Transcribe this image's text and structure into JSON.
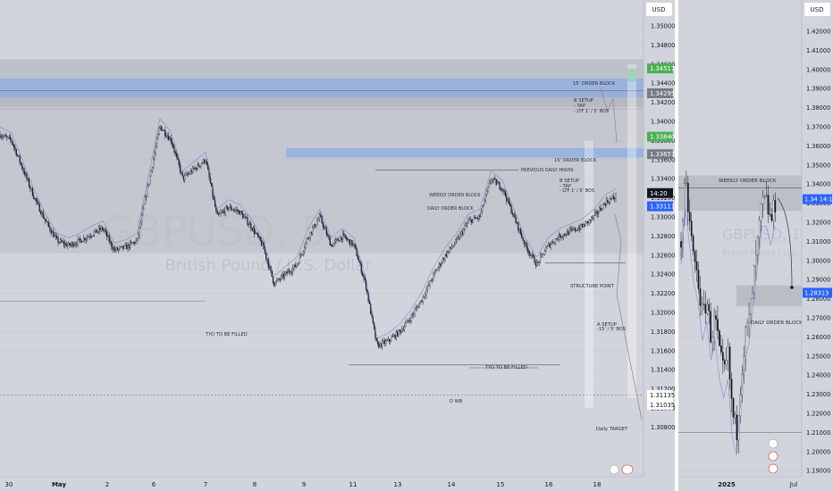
{
  "left_chart": {
    "currency": "USD",
    "price_ticks": [
      "1.35000",
      "1.34800",
      "1.34600",
      "1.34400",
      "1.34200",
      "1.34000",
      "1.33800",
      "1.33600",
      "1.33400",
      "1.33200",
      "1.33000",
      "1.32800",
      "1.32600",
      "1.32400",
      "1.32200",
      "1.32000",
      "1.31800",
      "1.31600",
      "1.31400",
      "1.31200",
      "1.31000",
      "1.30800"
    ],
    "price_labels": [
      {
        "value": "1.34517",
        "color": "#4caf50",
        "text_color": "#ffffff",
        "price": 1.34555
      },
      {
        "value": "1.34295",
        "color": "#787b86",
        "text_color": "#ffffff",
        "price": 1.34295
      },
      {
        "value": "1.33840",
        "color": "#4caf50",
        "text_color": "#ffffff",
        "price": 1.3384
      },
      {
        "value": "1.33657",
        "color": "#787b86",
        "text_color": "#ffffff",
        "price": 1.33657
      },
      {
        "value": "14:20",
        "color": "#131722",
        "text_color": "#ffffff",
        "price": 1.3325
      },
      {
        "value": "1.33111",
        "color": "#2962ff",
        "text_color": "#ffffff",
        "price": 1.33111
      },
      {
        "value": "1.31135",
        "color": "#ffffff",
        "text_color": "#131722",
        "price": 1.31135
      },
      {
        "value": "1.31035",
        "color": "#ffffff",
        "text_color": "#131722",
        "price": 1.31035
      }
    ],
    "time_ticks": [
      "30",
      "May",
      "2",
      "6",
      "7",
      "8",
      "9",
      "11",
      "13",
      "14",
      "15",
      "16",
      "18"
    ],
    "annotations": [
      "15' ORDER BLOCK",
      "B SETUP",
      "- TAP",
      "- LTF 1' / 5' BOS",
      "15' ORDER BLOCK",
      "PREVIOUS DAILY HIGHS",
      "B SETUP",
      "- TAP",
      "- LTF 1' / 5' BOS",
      "WEEKLY ORDER BLOCK",
      "DAILY ORDER BLOCK",
      "STRUCTURE POINT",
      "A SETUP",
      "-15' / 5' BOS",
      "TYO TO BE FILLED",
      "TYO TO BE FILLED",
      "D WB",
      "Daily TARGET"
    ],
    "watermark": {
      "symbol": "GBPUSD, 5",
      "name": "British Pound / U.S. Dollar"
    }
  },
  "right_chart": {
    "currency": "USD",
    "price_ticks": [
      "1.42000",
      "1.41000",
      "1.40000",
      "1.39000",
      "1.38000",
      "1.37000",
      "1.36000",
      "1.35000",
      "1.34000",
      "1.33000",
      "1.32000",
      "1.31000",
      "1.30000",
      "1.29000",
      "1.28000",
      "1.27000",
      "1.26000",
      "1.25000",
      "1.24000",
      "1.23000",
      "1.22000",
      "1.21000",
      "1.20000",
      "1.19000"
    ],
    "price_labels": [
      {
        "value": "1.34 14:19",
        "color": "#2962ff",
        "text_color": "#ffffff",
        "price": 1.3321
      },
      {
        "value": "1.28313",
        "color": "#2962ff",
        "text_color": "#ffffff",
        "price": 1.2831
      }
    ],
    "time_ticks": [
      "2025",
      "Jul"
    ],
    "annotations": [
      "WEEKLY ORDER BLOCK",
      "DAILY ORDER BLOCK"
    ],
    "watermark": {
      "symbol": "GBPUSD, 1W",
      "name": "British Pound / U.S. Dollar"
    }
  },
  "chart_data": [
    {
      "type": "candlestick",
      "title": "",
      "series_name": "",
      "x": [
        "30",
        "May",
        "2",
        "6",
        "7",
        "8",
        "9",
        "11",
        "13",
        "14",
        "15",
        "16",
        "18"
      ],
      "ylim": [
        1.3075,
        1.351
      ],
      "close_path": [
        [
          0,
          1.3386
        ],
        [
          1,
          1.338
        ],
        [
          2,
          1.335
        ],
        [
          3,
          1.332
        ],
        [
          4,
          1.3295
        ],
        [
          5,
          1.3275
        ],
        [
          6,
          1.327
        ],
        [
          7,
          1.3275
        ],
        [
          8,
          1.3282
        ],
        [
          9,
          1.3288
        ],
        [
          10,
          1.3265
        ],
        [
          11,
          1.3268
        ],
        [
          12,
          1.3275
        ],
        [
          13,
          1.3335
        ],
        [
          14,
          1.3395
        ],
        [
          15,
          1.338
        ],
        [
          16,
          1.334
        ],
        [
          17,
          1.335
        ],
        [
          18,
          1.336
        ],
        [
          19,
          1.33
        ],
        [
          20,
          1.331
        ],
        [
          21,
          1.3305
        ],
        [
          22,
          1.329
        ],
        [
          23,
          1.327
        ],
        [
          24,
          1.323
        ],
        [
          25,
          1.324
        ],
        [
          26,
          1.325
        ],
        [
          27,
          1.328
        ],
        [
          28,
          1.33
        ],
        [
          29,
          1.327
        ],
        [
          30,
          1.328
        ],
        [
          31,
          1.327
        ],
        [
          32,
          1.323
        ],
        [
          33,
          1.3165
        ],
        [
          34,
          1.317
        ],
        [
          35,
          1.318
        ],
        [
          36,
          1.3195
        ],
        [
          37,
          1.3215
        ],
        [
          38,
          1.324
        ],
        [
          39,
          1.326
        ],
        [
          40,
          1.3275
        ],
        [
          41,
          1.3295
        ],
        [
          42,
          1.33
        ],
        [
          43,
          1.334
        ],
        [
          44,
          1.333
        ],
        [
          45,
          1.33
        ],
        [
          46,
          1.327
        ],
        [
          47,
          1.325
        ],
        [
          48,
          1.327
        ],
        [
          49,
          1.328
        ],
        [
          50,
          1.3285
        ],
        [
          51,
          1.329
        ],
        [
          52,
          1.33
        ],
        [
          53,
          1.3315
        ],
        [
          54,
          1.3322
        ]
      ],
      "zones": [
        {
          "label": "15' ORDER BLOCK",
          "from": 1.3425,
          "to": 1.3445
        },
        {
          "label": "15' ORDER BLOCK",
          "from": 1.3362,
          "to": 1.3372
        },
        {
          "label": "WEEKLY ORDER BLOCK",
          "from": 1.3262,
          "to": 1.3432
        }
      ]
    },
    {
      "type": "candlestick",
      "title": "",
      "series_name": "",
      "x": [
        "2025",
        "Jul"
      ],
      "ylim": [
        1.186,
        1.43
      ],
      "close_path": [
        [
          0,
          1.31
        ],
        [
          1,
          1.34
        ],
        [
          2,
          1.32
        ],
        [
          3,
          1.3
        ],
        [
          4,
          1.29
        ],
        [
          5,
          1.27
        ],
        [
          6,
          1.28
        ],
        [
          7,
          1.26
        ],
        [
          8,
          1.27
        ],
        [
          9,
          1.25
        ],
        [
          10,
          1.24
        ],
        [
          11,
          1.25
        ],
        [
          12,
          1.22
        ],
        [
          13,
          1.21
        ],
        [
          14,
          1.24
        ],
        [
          15,
          1.26
        ],
        [
          16,
          1.27
        ],
        [
          17,
          1.29
        ],
        [
          18,
          1.31
        ],
        [
          19,
          1.33
        ],
        [
          20,
          1.33
        ],
        [
          21,
          1.32
        ],
        [
          22,
          1.33
        ]
      ],
      "zones": [
        {
          "label": "WEEKLY ORDER BLOCK",
          "from": 1.326,
          "to": 1.3445
        },
        {
          "label": "DAILY ORDER BLOCK",
          "from": 1.276,
          "to": 1.287
        }
      ]
    }
  ]
}
